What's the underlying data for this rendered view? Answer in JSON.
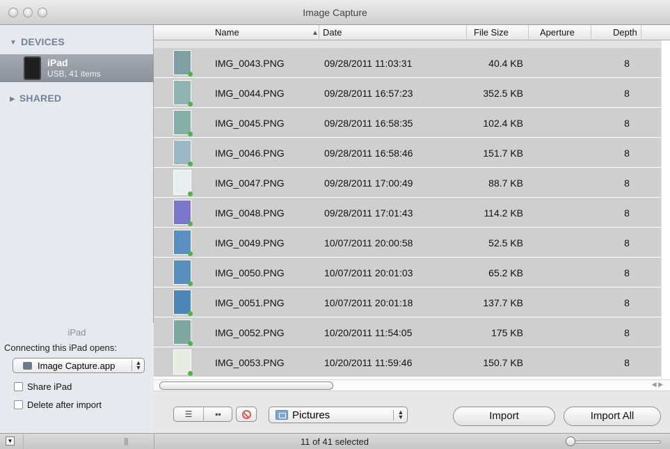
{
  "window": {
    "title": "Image Capture"
  },
  "sidebar": {
    "devices_header": "DEVICES",
    "device": {
      "name": "iPad",
      "subtitle": "USB, 41 items"
    },
    "shared_header": "SHARED",
    "bottom": {
      "device_label": "iPad",
      "opens_label": "Connecting this iPad opens:",
      "app_selected": "Image Capture.app",
      "share_label": "Share iPad",
      "share_checked": false,
      "delete_label": "Delete after import",
      "delete_checked": false
    }
  },
  "table": {
    "columns": [
      "Name",
      "Date",
      "File Size",
      "Aperture",
      "Depth"
    ],
    "rows": [
      {
        "name": "IMG_0043.PNG",
        "date": "09/28/2011 11:03:31",
        "size": "40.4 KB",
        "aperture": "",
        "depth": "8"
      },
      {
        "name": "IMG_0044.PNG",
        "date": "09/28/2011 16:57:23",
        "size": "352.5 KB",
        "aperture": "",
        "depth": "8"
      },
      {
        "name": "IMG_0045.PNG",
        "date": "09/28/2011 16:58:35",
        "size": "102.4 KB",
        "aperture": "",
        "depth": "8"
      },
      {
        "name": "IMG_0046.PNG",
        "date": "09/28/2011 16:58:46",
        "size": "151.7 KB",
        "aperture": "",
        "depth": "8"
      },
      {
        "name": "IMG_0047.PNG",
        "date": "09/28/2011 17:00:49",
        "size": "88.7 KB",
        "aperture": "",
        "depth": "8"
      },
      {
        "name": "IMG_0048.PNG",
        "date": "09/28/2011 17:01:43",
        "size": "114.2 KB",
        "aperture": "",
        "depth": "8"
      },
      {
        "name": "IMG_0049.PNG",
        "date": "10/07/2011 20:00:58",
        "size": "52.5 KB",
        "aperture": "",
        "depth": "8"
      },
      {
        "name": "IMG_0050.PNG",
        "date": "10/07/2011 20:01:03",
        "size": "65.2 KB",
        "aperture": "",
        "depth": "8"
      },
      {
        "name": "IMG_0051.PNG",
        "date": "10/07/2011 20:01:18",
        "size": "137.7 KB",
        "aperture": "",
        "depth": "8"
      },
      {
        "name": "IMG_0052.PNG",
        "date": "10/20/2011 11:54:05",
        "size": "175 KB",
        "aperture": "",
        "depth": "8"
      },
      {
        "name": "IMG_0053.PNG",
        "date": "10/20/2011 11:59:46",
        "size": "150.7 KB",
        "aperture": "",
        "depth": "8"
      }
    ]
  },
  "toolbar": {
    "destination": "Pictures",
    "import_label": "Import",
    "import_all_label": "Import All"
  },
  "status": {
    "text": "11 of 41 selected"
  }
}
